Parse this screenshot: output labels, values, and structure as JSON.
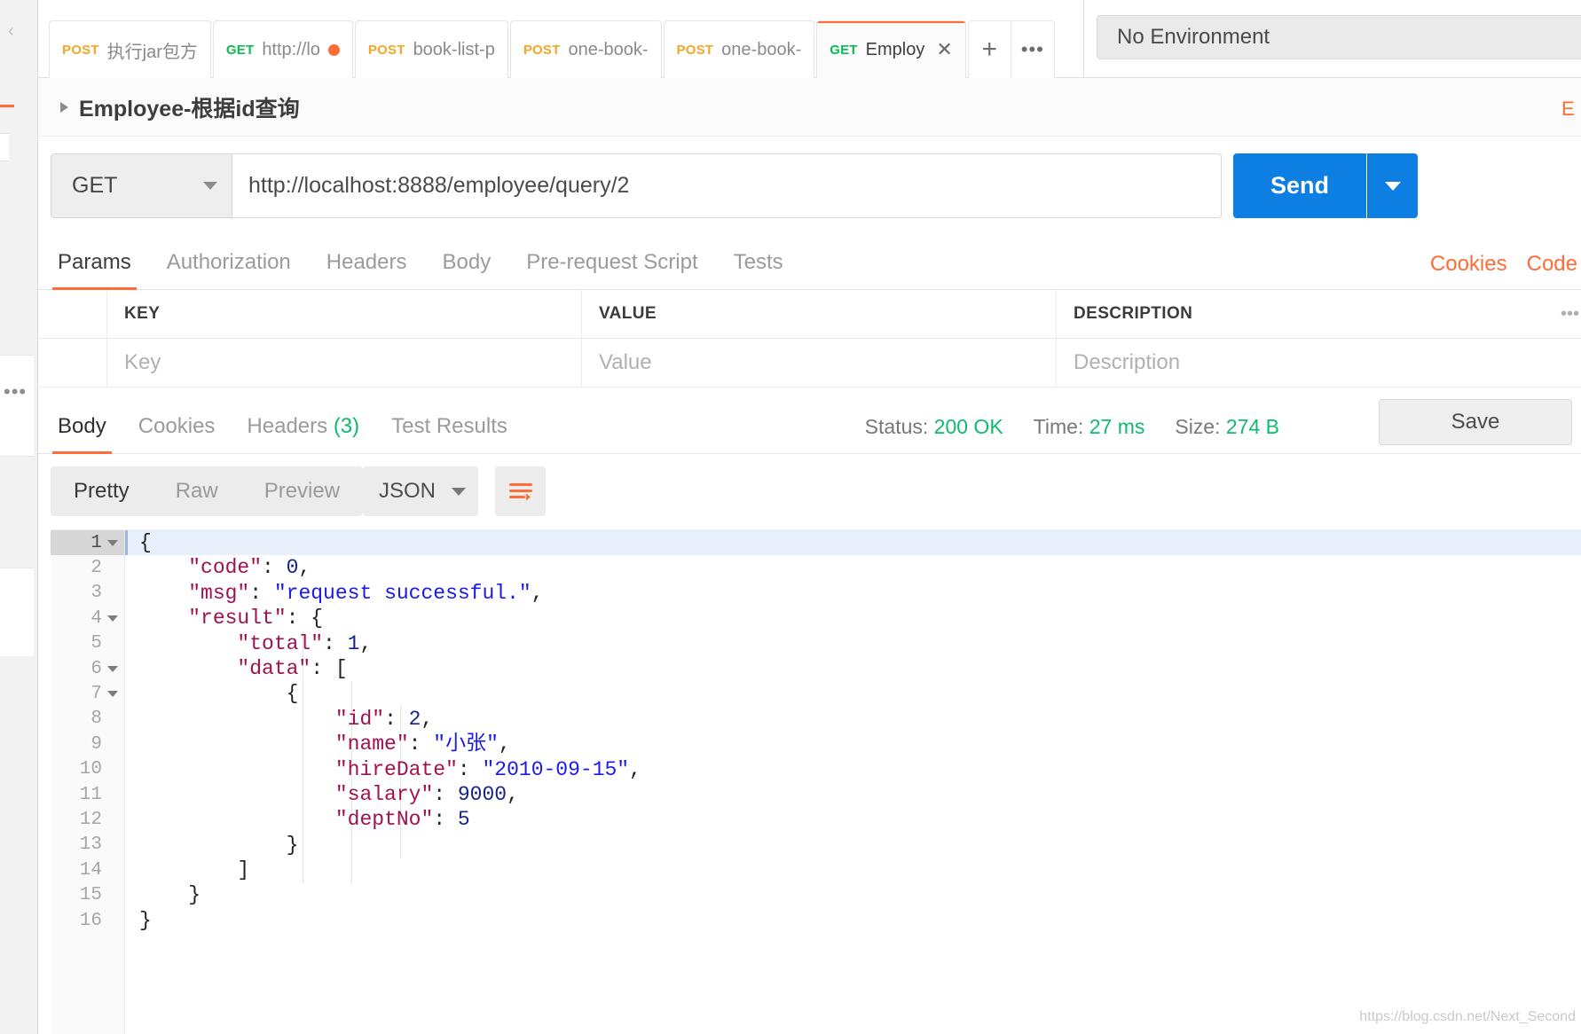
{
  "environment": {
    "selected": "No Environment"
  },
  "tabs": [
    {
      "method": "POST",
      "label": "执行jar包方",
      "unsaved": false,
      "active": false
    },
    {
      "method": "GET",
      "label": "http://lo",
      "unsaved": true,
      "active": false
    },
    {
      "method": "POST",
      "label": "book-list-p",
      "unsaved": false,
      "active": false
    },
    {
      "method": "POST",
      "label": "one-book-",
      "unsaved": false,
      "active": false
    },
    {
      "method": "POST",
      "label": "one-book-",
      "unsaved": false,
      "active": false
    },
    {
      "method": "GET",
      "label": "Employ",
      "unsaved": false,
      "active": true
    }
  ],
  "tab_controls": {
    "new_tab": "+",
    "more": "•••",
    "close": "✕"
  },
  "request": {
    "title": "Employee-根据id查询",
    "method": "GET",
    "url": "http://localhost:8888/employee/query/2",
    "send_label": "Send",
    "subtabs": [
      {
        "label": "Params",
        "active": true
      },
      {
        "label": "Authorization",
        "active": false
      },
      {
        "label": "Headers",
        "active": false
      },
      {
        "label": "Body",
        "active": false
      },
      {
        "label": "Pre-request Script",
        "active": false
      },
      {
        "label": "Tests",
        "active": false
      }
    ],
    "links": [
      {
        "label": "Cookies"
      },
      {
        "label": "Code"
      }
    ]
  },
  "params_table": {
    "headers": [
      "KEY",
      "VALUE",
      "DESCRIPTION"
    ],
    "placeholders": {
      "key": "Key",
      "value": "Value",
      "description": "Description"
    },
    "bulk_icon": "•••"
  },
  "response": {
    "tabs": [
      {
        "label": "Body",
        "active": true,
        "count": ""
      },
      {
        "label": "Cookies",
        "active": false,
        "count": ""
      },
      {
        "label": "Headers",
        "active": false,
        "count": "(3)"
      },
      {
        "label": "Test Results",
        "active": false,
        "count": ""
      }
    ],
    "meta": {
      "status_label": "Status:",
      "status_value": "200 OK",
      "time_label": "Time:",
      "time_value": "27 ms",
      "size_label": "Size:",
      "size_value": "274 B"
    },
    "save_label": "Save",
    "viewer": {
      "modes": [
        {
          "label": "Pretty",
          "active": true
        },
        {
          "label": "Raw",
          "active": false
        },
        {
          "label": "Preview",
          "active": false
        }
      ],
      "format": "JSON",
      "wrap_icon": "wrap-lines-icon"
    },
    "body_lines": [
      {
        "n": "1",
        "fold": true,
        "current": true,
        "tokens": [
          {
            "t": "pun",
            "v": "{"
          }
        ]
      },
      {
        "n": "2",
        "fold": false,
        "current": false,
        "tokens": [
          {
            "t": "pun",
            "v": "    "
          },
          {
            "t": "key",
            "v": "\"code\""
          },
          {
            "t": "pun",
            "v": ": "
          },
          {
            "t": "num",
            "v": "0"
          },
          {
            "t": "pun",
            "v": ","
          }
        ]
      },
      {
        "n": "3",
        "fold": false,
        "current": false,
        "tokens": [
          {
            "t": "pun",
            "v": "    "
          },
          {
            "t": "key",
            "v": "\"msg\""
          },
          {
            "t": "pun",
            "v": ": "
          },
          {
            "t": "str",
            "v": "\"request successful.\""
          },
          {
            "t": "pun",
            "v": ","
          }
        ]
      },
      {
        "n": "4",
        "fold": true,
        "current": false,
        "tokens": [
          {
            "t": "pun",
            "v": "    "
          },
          {
            "t": "key",
            "v": "\"result\""
          },
          {
            "t": "pun",
            "v": ": {"
          }
        ]
      },
      {
        "n": "5",
        "fold": false,
        "current": false,
        "tokens": [
          {
            "t": "pun",
            "v": "        "
          },
          {
            "t": "key",
            "v": "\"total\""
          },
          {
            "t": "pun",
            "v": ": "
          },
          {
            "t": "num",
            "v": "1"
          },
          {
            "t": "pun",
            "v": ","
          }
        ]
      },
      {
        "n": "6",
        "fold": true,
        "current": false,
        "tokens": [
          {
            "t": "pun",
            "v": "        "
          },
          {
            "t": "key",
            "v": "\"data\""
          },
          {
            "t": "pun",
            "v": ": ["
          }
        ]
      },
      {
        "n": "7",
        "fold": true,
        "current": false,
        "tokens": [
          {
            "t": "pun",
            "v": "            {"
          }
        ]
      },
      {
        "n": "8",
        "fold": false,
        "current": false,
        "tokens": [
          {
            "t": "pun",
            "v": "                "
          },
          {
            "t": "key",
            "v": "\"id\""
          },
          {
            "t": "pun",
            "v": ": "
          },
          {
            "t": "num",
            "v": "2"
          },
          {
            "t": "pun",
            "v": ","
          }
        ]
      },
      {
        "n": "9",
        "fold": false,
        "current": false,
        "tokens": [
          {
            "t": "pun",
            "v": "                "
          },
          {
            "t": "key",
            "v": "\"name\""
          },
          {
            "t": "pun",
            "v": ": "
          },
          {
            "t": "str",
            "v": "\"小张\""
          },
          {
            "t": "pun",
            "v": ","
          }
        ]
      },
      {
        "n": "10",
        "fold": false,
        "current": false,
        "tokens": [
          {
            "t": "pun",
            "v": "                "
          },
          {
            "t": "key",
            "v": "\"hireDate\""
          },
          {
            "t": "pun",
            "v": ": "
          },
          {
            "t": "str",
            "v": "\"2010-09-15\""
          },
          {
            "t": "pun",
            "v": ","
          }
        ]
      },
      {
        "n": "11",
        "fold": false,
        "current": false,
        "tokens": [
          {
            "t": "pun",
            "v": "                "
          },
          {
            "t": "key",
            "v": "\"salary\""
          },
          {
            "t": "pun",
            "v": ": "
          },
          {
            "t": "num",
            "v": "9000"
          },
          {
            "t": "pun",
            "v": ","
          }
        ]
      },
      {
        "n": "12",
        "fold": false,
        "current": false,
        "tokens": [
          {
            "t": "pun",
            "v": "                "
          },
          {
            "t": "key",
            "v": "\"deptNo\""
          },
          {
            "t": "pun",
            "v": ": "
          },
          {
            "t": "num",
            "v": "5"
          }
        ]
      },
      {
        "n": "13",
        "fold": false,
        "current": false,
        "tokens": [
          {
            "t": "pun",
            "v": "            }"
          }
        ]
      },
      {
        "n": "14",
        "fold": false,
        "current": false,
        "tokens": [
          {
            "t": "pun",
            "v": "        ]"
          }
        ]
      },
      {
        "n": "15",
        "fold": false,
        "current": false,
        "tokens": [
          {
            "t": "pun",
            "v": "    }"
          }
        ]
      },
      {
        "n": "16",
        "fold": false,
        "current": false,
        "tokens": [
          {
            "t": "pun",
            "v": "}"
          }
        ]
      }
    ]
  },
  "watermark": "https://blog.csdn.net/Next_Second",
  "colors": {
    "accent_orange": "#ff6c37",
    "send_blue": "#0d7ee2",
    "status_green": "#0fbb6e",
    "get_green": "#0cbb52",
    "post_yellow": "#f5a623",
    "json_key": "#a11050",
    "json_string": "#1a1ae8",
    "json_number": "#17228f"
  }
}
